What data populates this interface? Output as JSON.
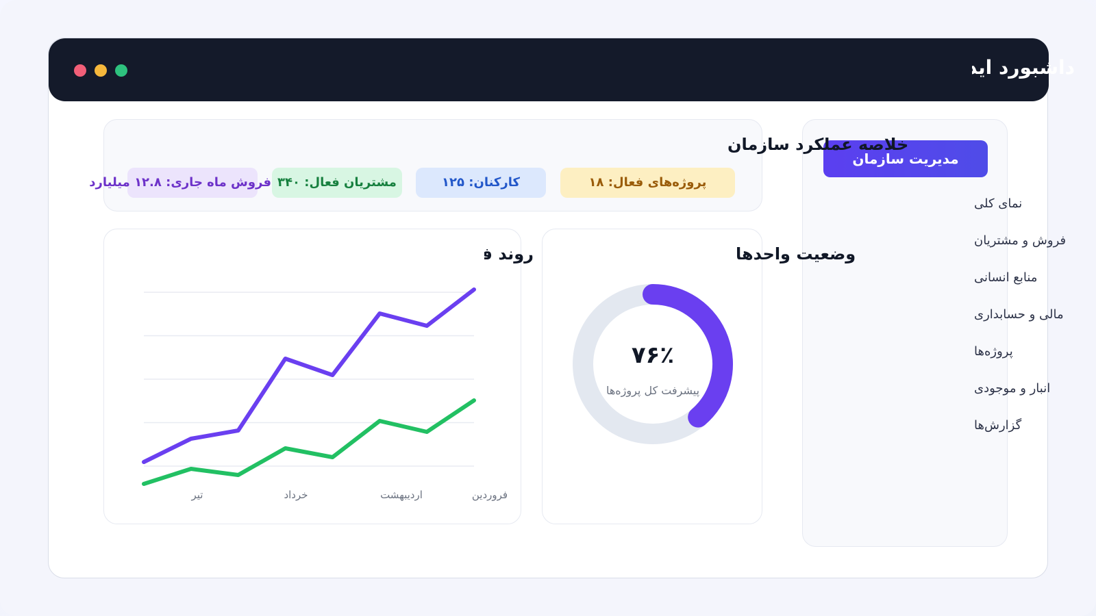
{
  "app": {
    "title": "داشبورد ایده‌آل"
  },
  "sidebar": {
    "header": "مدیریت سازمان",
    "items": [
      {
        "label": "نمای کلی"
      },
      {
        "label": "فروش و مشتریان"
      },
      {
        "label": "منابع انسانی"
      },
      {
        "label": "مالی و حسابداری"
      },
      {
        "label": "پروژه‌ها"
      },
      {
        "label": "انبار و موجودی"
      },
      {
        "label": "گزارش‌ها"
      }
    ]
  },
  "summary": {
    "title": "خلاصه عملکرد سازمان",
    "stats": {
      "projects": "پروژه‌های فعال: ۱۸",
      "staff": "کارکنان: ۱۲۵",
      "customers": "مشتریان فعال: ۳۴۰",
      "sales": "فروش ماه جاری: ۱۲.۸ میلیارد"
    }
  },
  "units": {
    "title": "وضعیت واحدها",
    "progress_value": "۷۶٪",
    "progress_fraction": 0.76,
    "progress_caption": "پیشرفت کل پروژه‌ها"
  },
  "colors": {
    "purple": "#6a3ff0",
    "green": "#22c063",
    "track": "#e3e8f0"
  },
  "chart": {
    "title": "روند فروش و وصول"
  },
  "chart_data": {
    "type": "line",
    "x": [
      "فروردین",
      "",
      "اردیبهشت",
      "",
      "خرداد",
      "",
      "تیر",
      ""
    ],
    "tick_labels": [
      "فروردین",
      "اردیبهشت",
      "خرداد",
      "تیر"
    ],
    "series": [
      {
        "values": [
          100,
          80,
          76,
          60,
          56,
          40,
          36,
          20
        ]
      },
      {
        "values": [
          48,
          36,
          38,
          28,
          30,
          18,
          20,
          14
        ]
      }
    ],
    "ylim": [
      0,
      120
    ],
    "grid": true
  }
}
